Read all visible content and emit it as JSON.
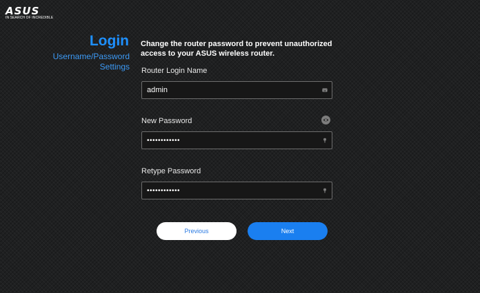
{
  "brand": {
    "logo_text": "ASUS",
    "tagline": "IN SEARCH OF INCREDIBLE"
  },
  "sidebar": {
    "title": "Login",
    "subtitle": "Username/Password Settings"
  },
  "main": {
    "heading": "Change the router password to prevent unauthorized access to your ASUS wireless router.",
    "fields": [
      {
        "label": "Router Login Name",
        "value": "admin",
        "type": "text",
        "icon": "keyboard-icon"
      },
      {
        "label": "New Password",
        "value": "asuspassword",
        "type": "password",
        "icon": "key-icon"
      },
      {
        "label": "Retype Password",
        "value": "asuspassword",
        "type": "password",
        "icon": "key-icon"
      }
    ],
    "show_password_icon": "eye-icon"
  },
  "buttons": {
    "previous_label": "Previous",
    "next_label": "Next"
  },
  "colors": {
    "accent": "#1a7ff0",
    "title": "#1e90ff",
    "background": "#1f2021"
  }
}
